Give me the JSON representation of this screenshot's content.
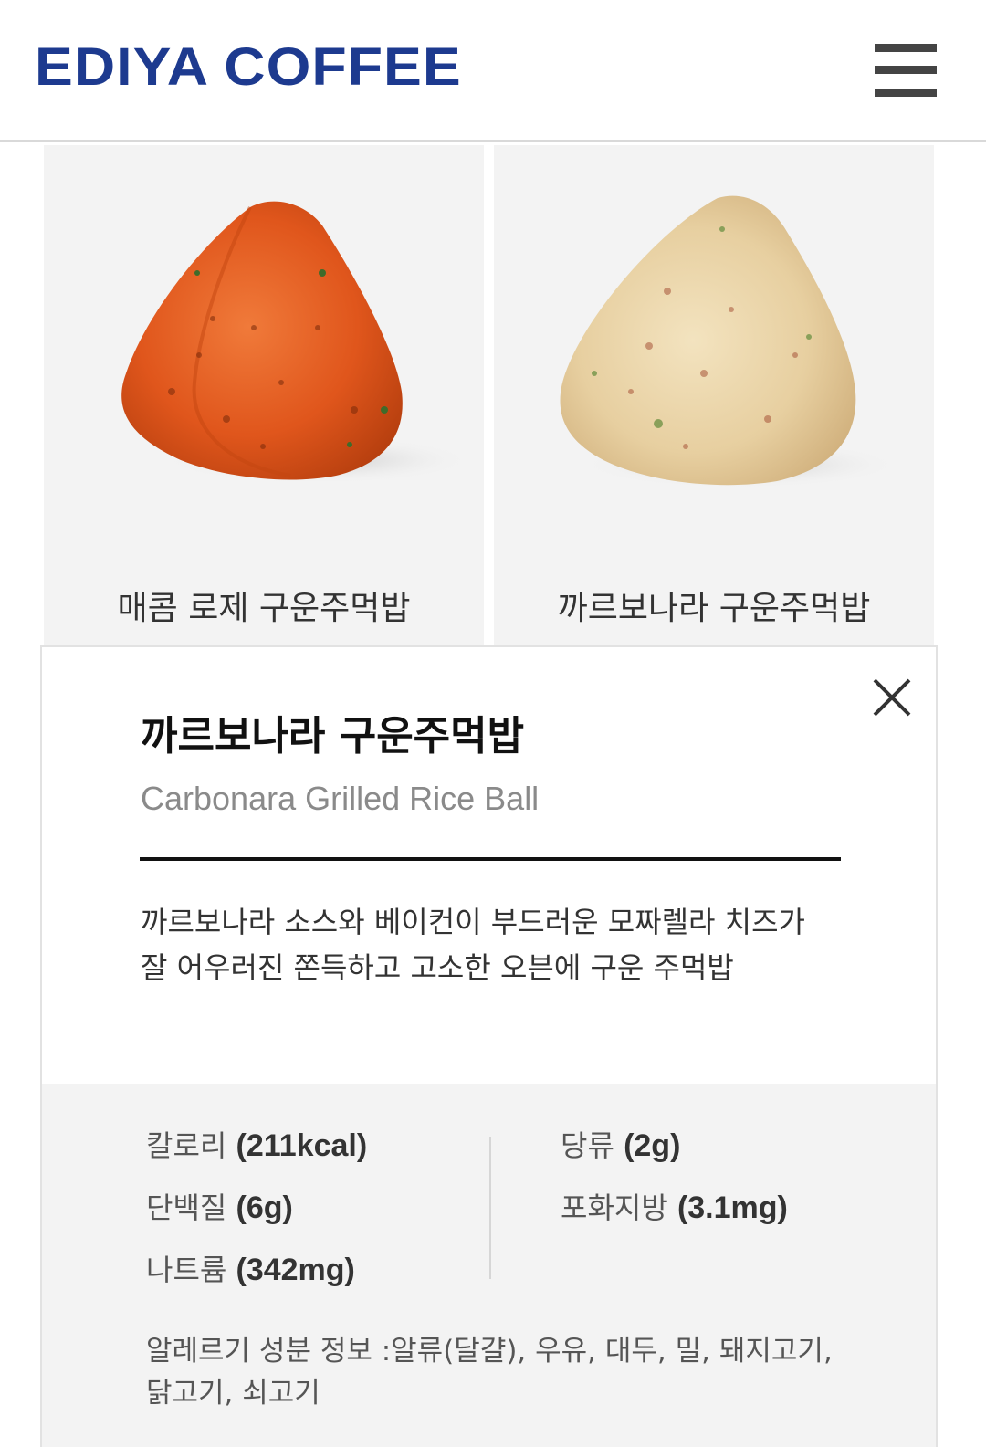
{
  "header": {
    "logo": "EDIYA COFFEE",
    "menu_icon": "hamburger-menu-icon"
  },
  "products": [
    {
      "name": "매콤 로제 구운주먹밥",
      "image": "spicy-rose-rice-ball-image",
      "color": "#d95a22"
    },
    {
      "name": "까르보나라 구운주먹밥",
      "image": "carbonara-rice-ball-image",
      "color": "#e8d3a8"
    }
  ],
  "detail": {
    "title_ko": "까르보나라 구운주먹밥",
    "title_en": "Carbonara Grilled Rice Ball",
    "description": "까르보나라 소스와 베이컨이 부드러운 모짜렐라 치즈가 잘 어우러진 쫀득하고 고소한 오븐에 구운 주먹밥",
    "close_icon": "close-icon",
    "nutrition": {
      "calories": {
        "label": "칼로리",
        "value": "(211kcal)"
      },
      "protein": {
        "label": "단백질",
        "value": "(6g)"
      },
      "sodium": {
        "label": "나트륨",
        "value": "(342mg)"
      },
      "sugar": {
        "label": "당류",
        "value": "(2g)"
      },
      "saturated_fat": {
        "label": "포화지방",
        "value": "(3.1mg)"
      }
    },
    "allergy": "알레르기 성분 정보 :알류(달걀), 우유, 대두, 밀, 돼지고기, 닭고기, 쇠고기"
  },
  "colors": {
    "brand": "#1d3a8f",
    "card_bg": "#f3f3f3",
    "text_dark": "#111111",
    "text_muted": "#8a8a8a"
  }
}
